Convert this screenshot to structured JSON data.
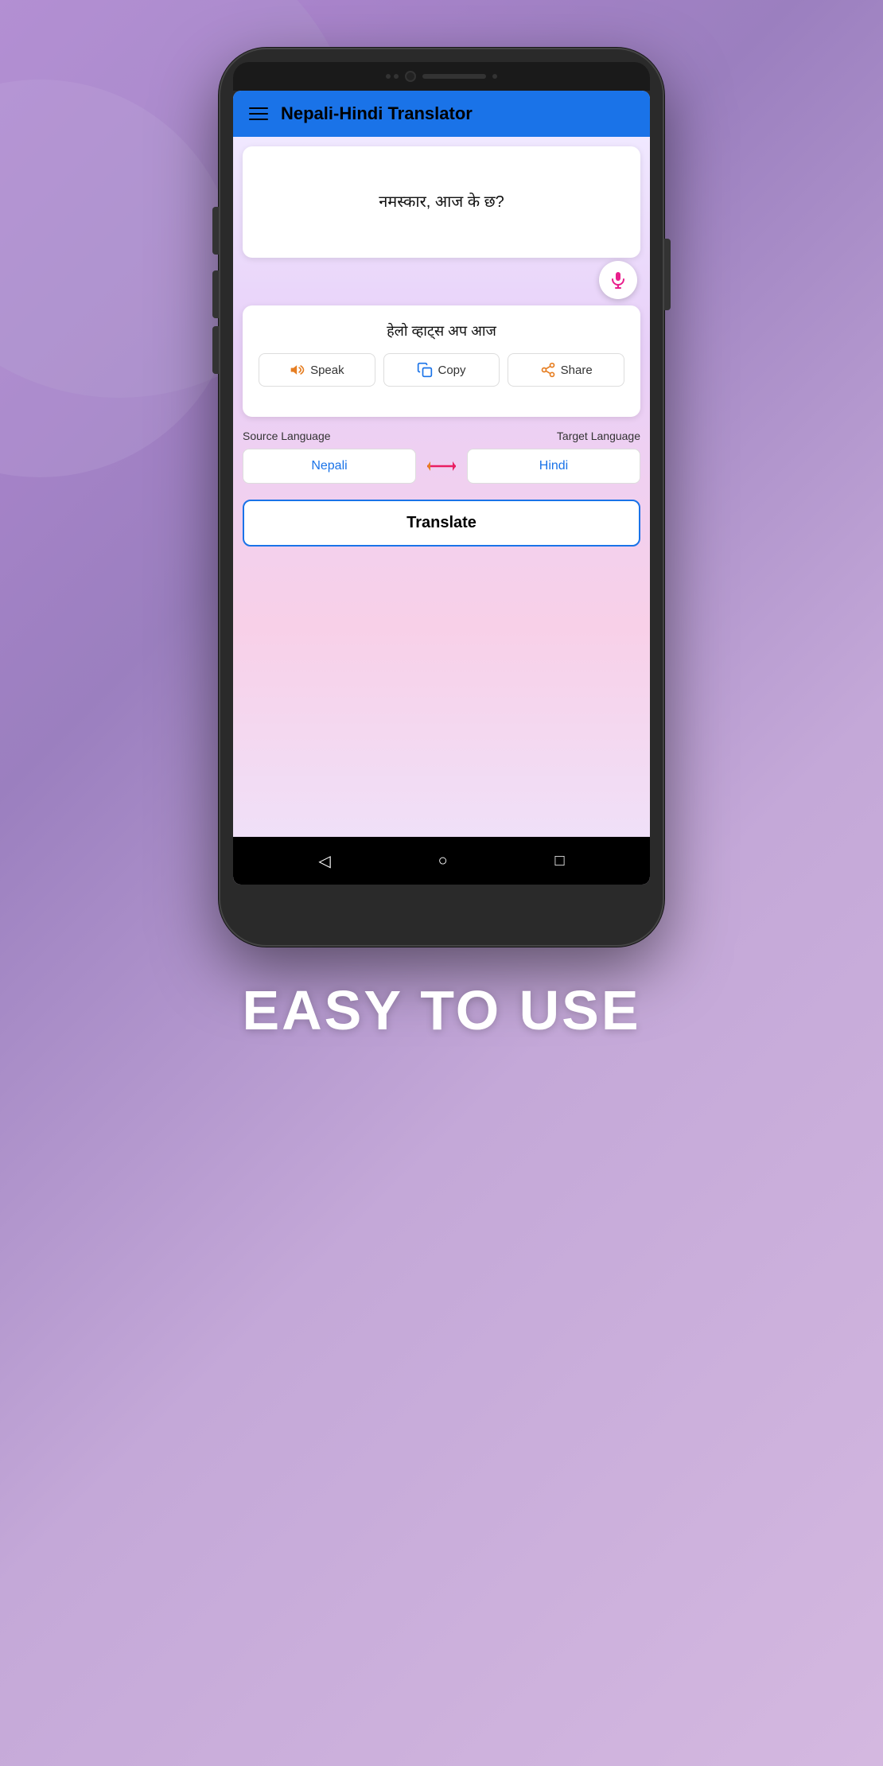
{
  "app": {
    "title": "Nepali-Hindi Translator",
    "hamburger_label": "Menu"
  },
  "input": {
    "text": "नमस्कार, आज के छ?"
  },
  "output": {
    "text": "हेलो व्हाट्स अप आज"
  },
  "actions": {
    "speak": "Speak",
    "copy": "Copy",
    "share": "Share"
  },
  "language": {
    "source_label": "Source Language",
    "target_label": "Target Language",
    "source_value": "Nepali",
    "target_value": "Hindi"
  },
  "translate_button": "Translate",
  "tagline": "EASY TO USE",
  "mic_aria": "Microphone",
  "nav": {
    "back": "◁",
    "home": "○",
    "recent": "□"
  }
}
